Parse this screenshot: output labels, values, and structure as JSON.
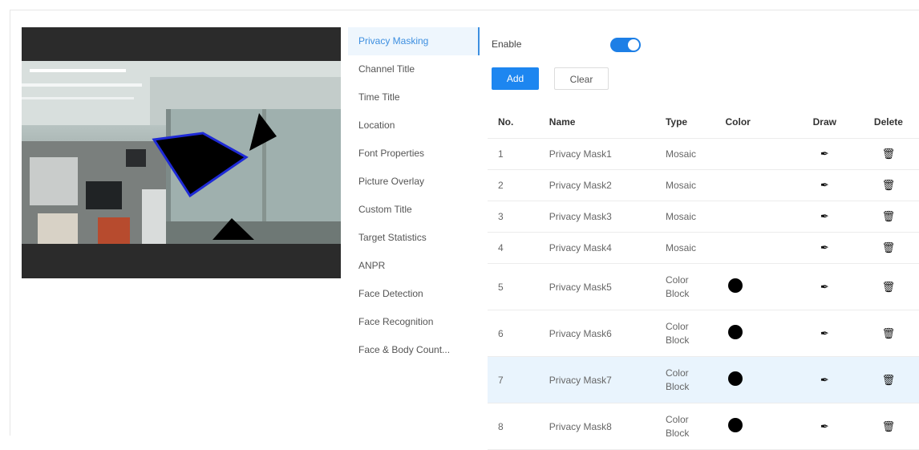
{
  "menu": {
    "items": [
      {
        "label": "Privacy Masking",
        "active": true
      },
      {
        "label": "Channel Title"
      },
      {
        "label": "Time Title"
      },
      {
        "label": "Location"
      },
      {
        "label": "Font Properties"
      },
      {
        "label": "Picture Overlay"
      },
      {
        "label": "Custom Title"
      },
      {
        "label": "Target Statistics"
      },
      {
        "label": "ANPR"
      },
      {
        "label": "Face Detection"
      },
      {
        "label": "Face Recognition"
      },
      {
        "label": "Face & Body Count..."
      }
    ]
  },
  "settings": {
    "enable_label": "Enable",
    "enabled": true,
    "add_label": "Add",
    "clear_label": "Clear"
  },
  "table": {
    "headers": {
      "no": "No.",
      "name": "Name",
      "type": "Type",
      "color": "Color",
      "draw": "Draw",
      "delete": "Delete"
    },
    "rows": [
      {
        "no": "1",
        "name": "Privacy Mask1",
        "type": "Mosaic",
        "color": ""
      },
      {
        "no": "2",
        "name": "Privacy Mask2",
        "type": "Mosaic",
        "color": ""
      },
      {
        "no": "3",
        "name": "Privacy Mask3",
        "type": "Mosaic",
        "color": ""
      },
      {
        "no": "4",
        "name": "Privacy Mask4",
        "type": "Mosaic",
        "color": ""
      },
      {
        "no": "5",
        "name": "Privacy Mask5",
        "type": "Color Block",
        "color": "#000000"
      },
      {
        "no": "6",
        "name": "Privacy Mask6",
        "type": "Color Block",
        "color": "#000000"
      },
      {
        "no": "7",
        "name": "Privacy Mask7",
        "type": "Color Block",
        "color": "#000000",
        "highlighted": true
      },
      {
        "no": "8",
        "name": "Privacy Mask8",
        "type": "Color Block",
        "color": "#000000"
      }
    ]
  },
  "icons": {
    "draw": "pencil-icon",
    "delete": "trash-icon"
  },
  "colors": {
    "accent": "#1d86f0",
    "active_menu_bg": "#eef6fd",
    "highlight_row": "#e9f4fd"
  }
}
